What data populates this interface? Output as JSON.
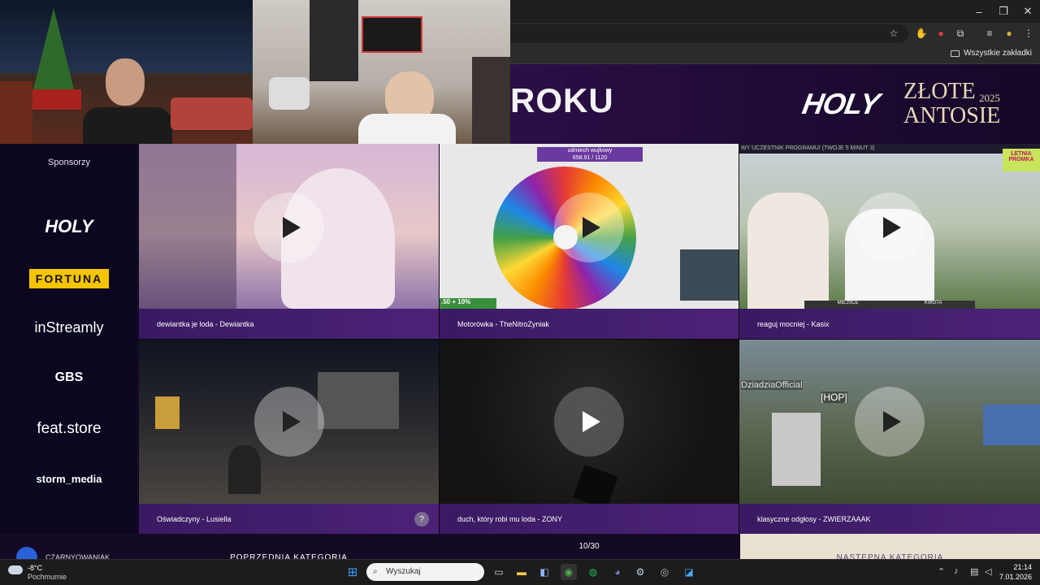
{
  "browser": {
    "bookmarks_label": "Wszystkie zakładki",
    "minimize": "–",
    "restore": "❐",
    "close": "✕"
  },
  "banner": {
    "title": "ROKU",
    "holy": "HOLY",
    "zlote_line1": "ZŁOTE",
    "zlote_line2": "ANTOSIE",
    "year": "2025"
  },
  "sidebar": {
    "title": "Sponsorzy",
    "sponsors": [
      "HOLY",
      "FORTUNA",
      "inStreamly",
      "GBS",
      "feat.store",
      "storm_media"
    ]
  },
  "tiles": [
    {
      "caption": "dewiantka je loda - Dewiantka"
    },
    {
      "caption": "Motorówka - TheNitroZyniak"
    },
    {
      "caption": "reaguj mocniej - Kasix"
    },
    {
      "caption": "Oświadczyny - Lusiella"
    },
    {
      "caption": "duch, który robi mu loda - ZONY"
    },
    {
      "caption": "klasyczne odgłosy - ZWIERZAAAK"
    }
  ],
  "tile_texts": {
    "wheel_header": "udmiech wujkowy",
    "wheel_counter": "658.91 / 1120",
    "wheel_bonus": ".50 + 10%",
    "kasix_top": "WY UCZESTNIK PROGRAMU! (TWOJE 5 MINUT 3)",
    "kasix_promo": "LETNIA PROMKA",
    "kasix_left": "MIEJSCE",
    "kasix_right": "KWOTA",
    "mc_name": "DziadziaOfficial",
    "mc_tag": "[HOP]",
    "help": "?"
  },
  "pager": {
    "text": "10/30",
    "prev": "POPRZEDNIA KATEGORIA",
    "next": "NASTĘPNA KATEGORIA"
  },
  "user": {
    "name": "CZARNYOWANIAK"
  },
  "taskbar": {
    "weather_temp": "-8°C",
    "weather_cond": "Pochmurnie",
    "search_placeholder": "Wyszukaj",
    "time": "21:14",
    "date": "7.01.2026"
  },
  "colors": {
    "accent": "#4c2278",
    "banner": "#2b0e46",
    "fortuna": "#f5c400"
  }
}
